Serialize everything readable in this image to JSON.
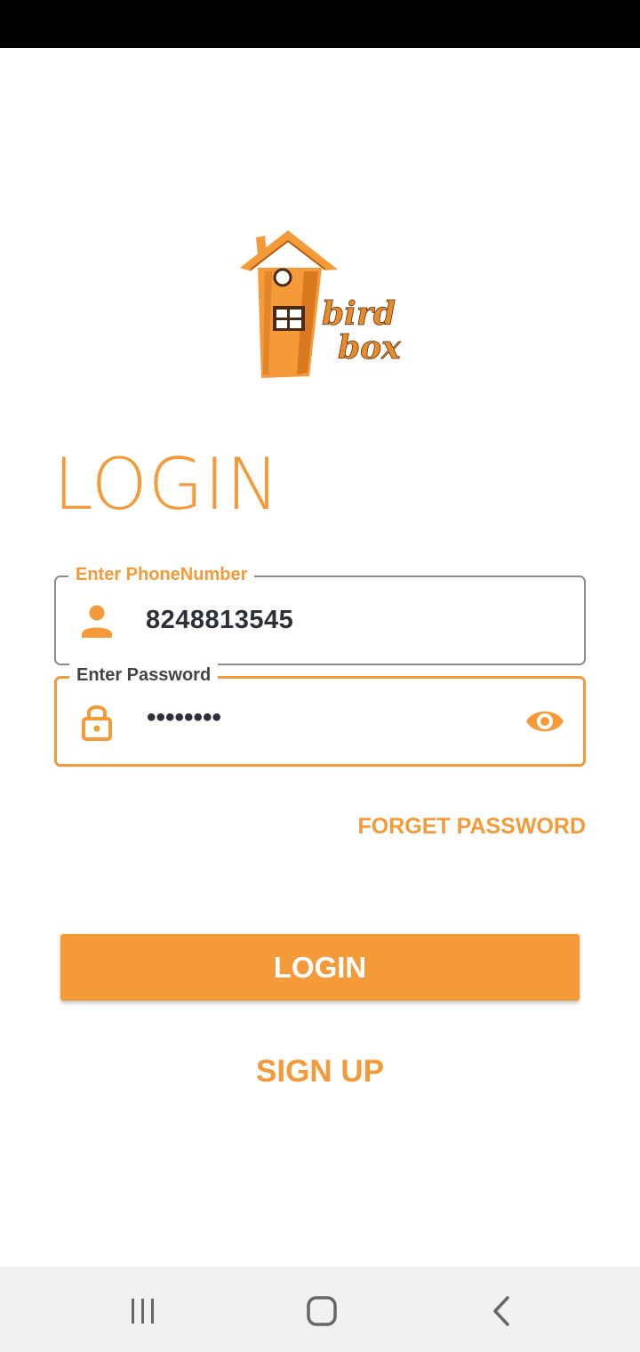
{
  "colors": {
    "accent": "#f59a38",
    "text_dark": "#2e2f3a",
    "border_gray": "#8c8c8c",
    "nav_bg": "#f1f1f1"
  },
  "logo": {
    "text_line1": "bird",
    "text_line2": "box",
    "icon": "bird-house-logo"
  },
  "login": {
    "title": "LOGIN",
    "phone_field": {
      "label": "Enter PhoneNumber",
      "value": "8248813545",
      "icon": "person-icon"
    },
    "password_field": {
      "label": "Enter Password",
      "value": "••••••••",
      "icon": "lock-icon",
      "toggle_icon": "eye-icon"
    },
    "forget_password": "FORGET PASSWORD",
    "login_button": "LOGIN",
    "signup": "SIGN UP"
  },
  "navigation": {
    "recents_icon": "recents-icon",
    "home_icon": "home-icon",
    "back_icon": "back-icon"
  }
}
